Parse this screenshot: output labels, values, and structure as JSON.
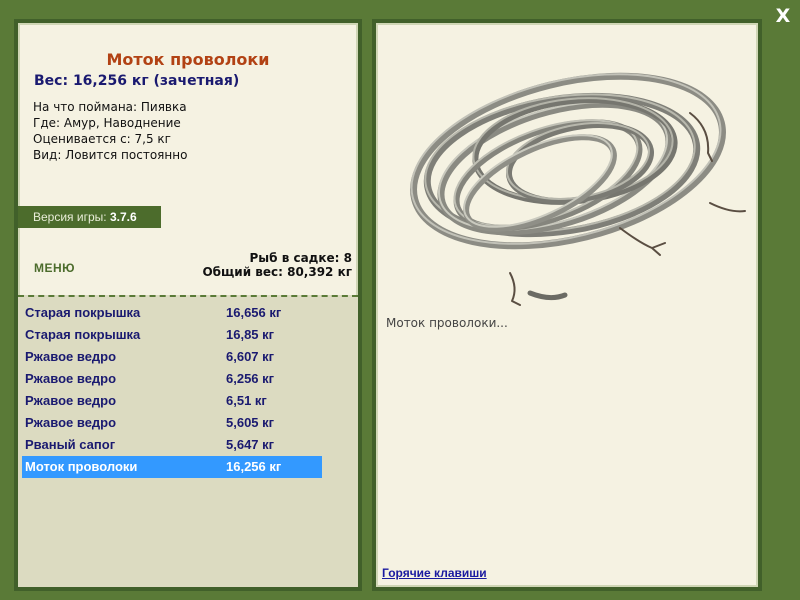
{
  "window": {
    "close_label": "X"
  },
  "fish": {
    "name": "Моток проволоки",
    "weight_line": "Вес: 16,256 кг (зачетная)",
    "bait_line": "На что поймана: Пиявка",
    "location_line": "Где: Амур, Наводнение",
    "rating_line": "Оценивается с: 7,5 кг",
    "type_line": "Вид: Ловится постоянно"
  },
  "version": {
    "label": "Версия игры:",
    "value": "3.7.6"
  },
  "menu": {
    "label": "МЕНЮ"
  },
  "cage": {
    "count_line": "Рыб в садке: 8",
    "total_line": "Общий вес: 80,392 кг"
  },
  "catch_list": [
    {
      "name": "Старая покрышка",
      "weight": "16,656 кг",
      "selected": false
    },
    {
      "name": "Старая покрышка",
      "weight": "16,85 кг",
      "selected": false
    },
    {
      "name": "Ржавое ведро",
      "weight": "6,607 кг",
      "selected": false
    },
    {
      "name": "Ржавое ведро",
      "weight": "6,256 кг",
      "selected": false
    },
    {
      "name": "Ржавое ведро",
      "weight": "6,51 кг",
      "selected": false
    },
    {
      "name": "Ржавое ведро",
      "weight": "5,605 кг",
      "selected": false
    },
    {
      "name": "Рваный сапог",
      "weight": "5,647 кг",
      "selected": false
    },
    {
      "name": "Моток проволоки",
      "weight": "16,256 кг",
      "selected": true
    }
  ],
  "preview": {
    "image_icon": "wire-coil-image",
    "caption": "Моток проволоки...",
    "hotkeys_label": "Горячие клавиши"
  },
  "colors": {
    "frame_green": "#5a7a37",
    "panel_bg": "#f5f2e2",
    "title_orange": "#b24214",
    "text_navy": "#1a1a70",
    "selection_blue": "#3399ff"
  }
}
